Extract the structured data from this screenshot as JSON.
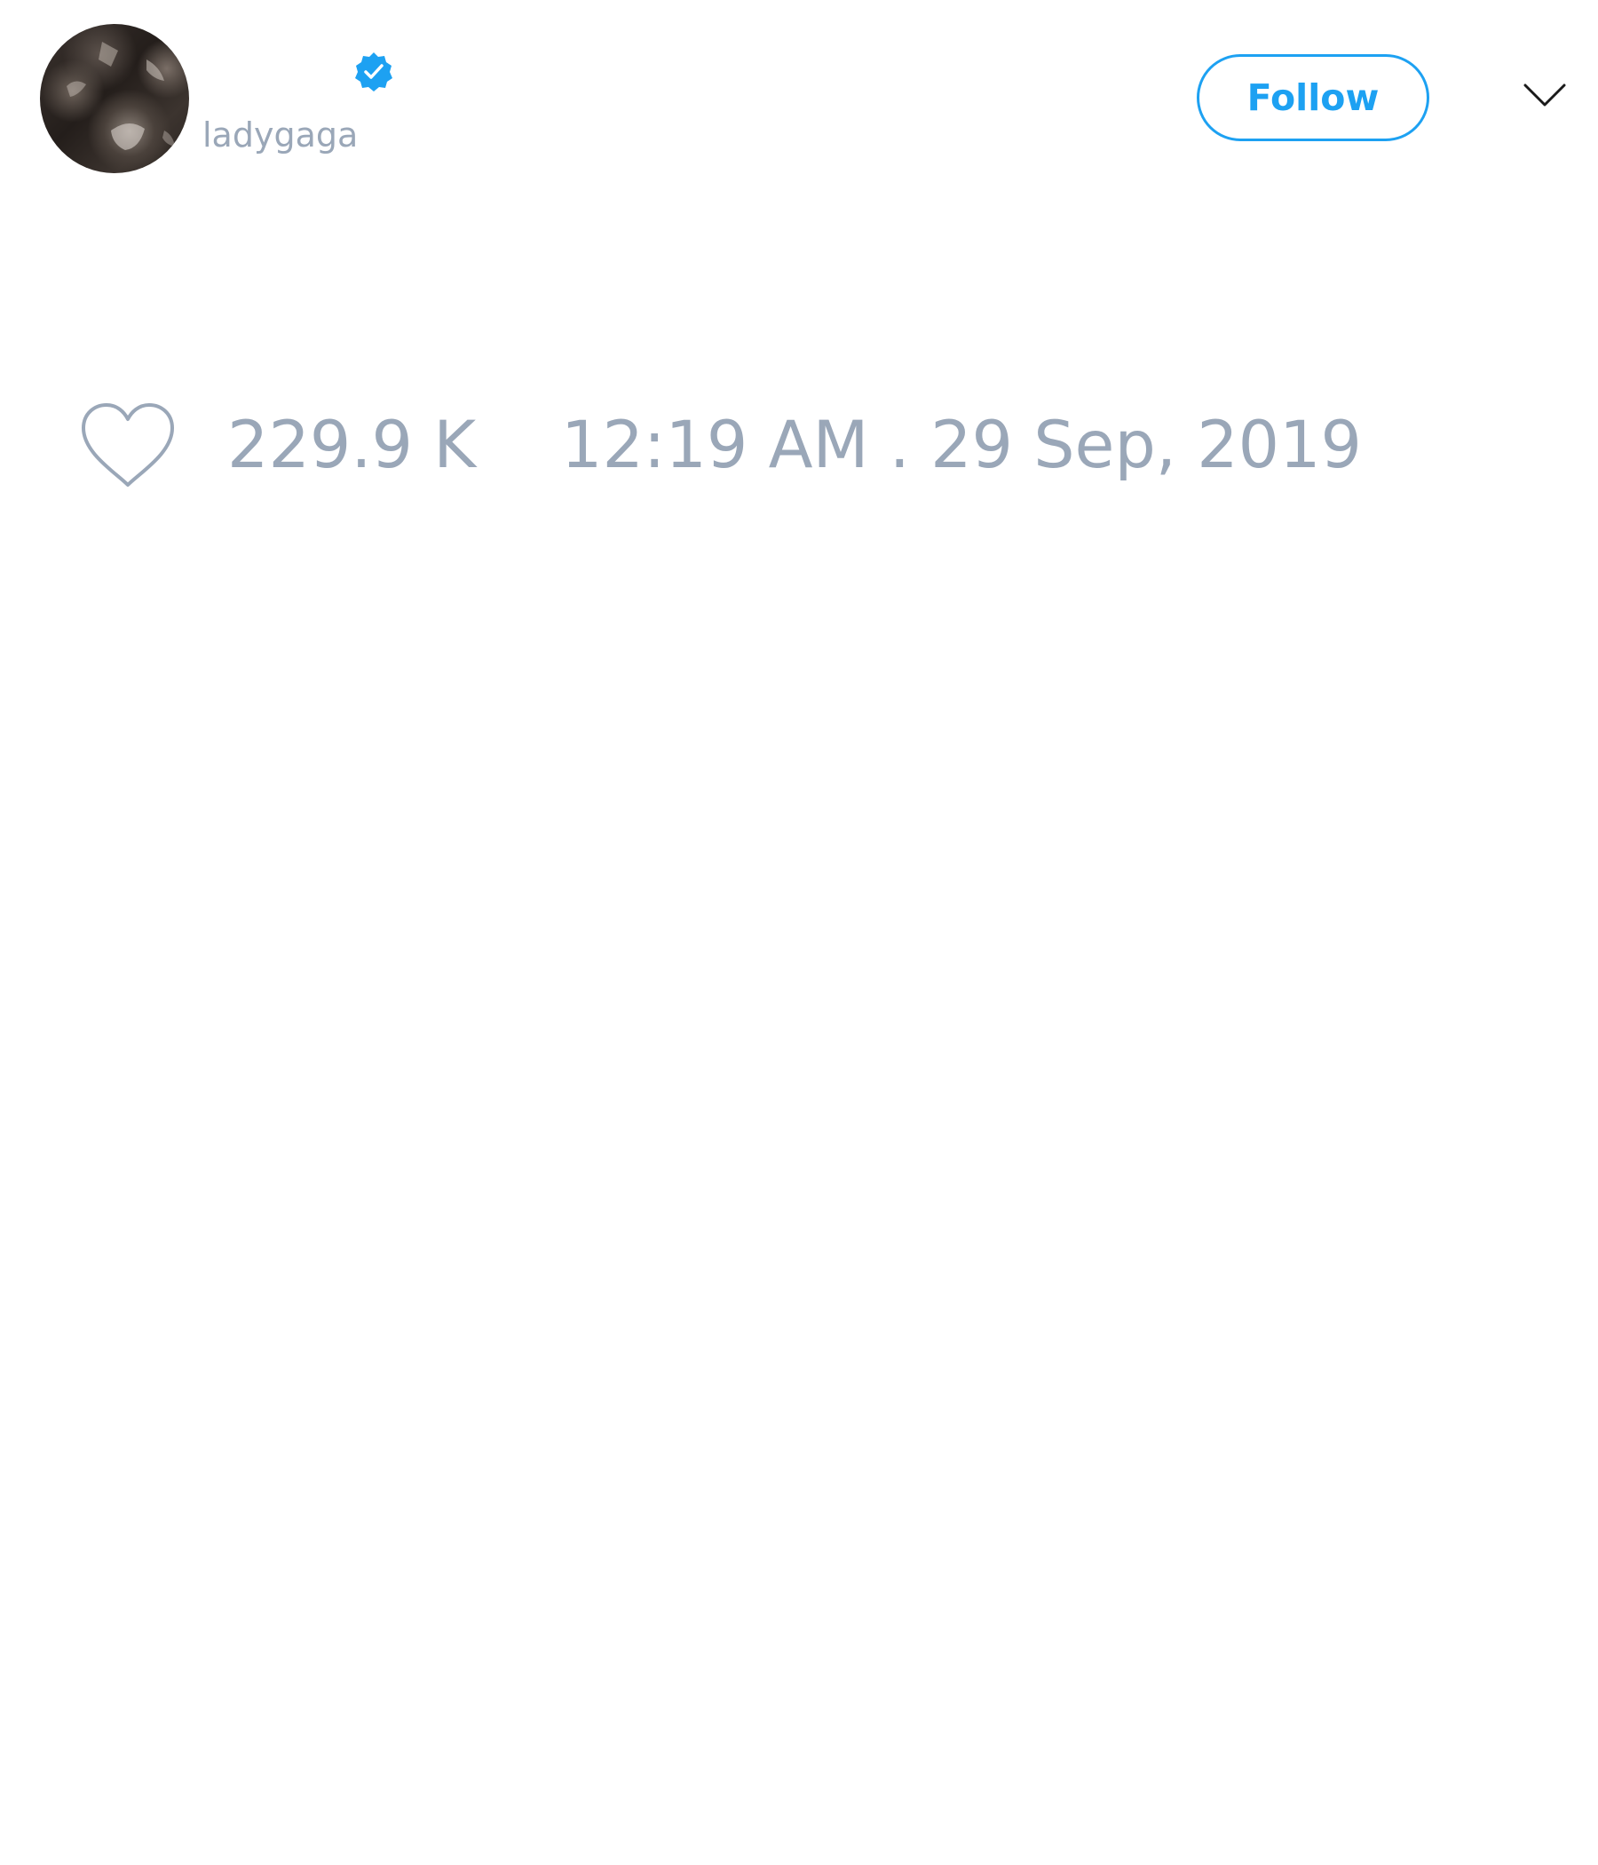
{
  "tweet": {
    "author": {
      "display_name": "",
      "handle": "ladygaga",
      "verified": true,
      "avatar_icon": "avatar-photo"
    },
    "follow_label": "Follow",
    "menu_icon": "chevron-down-icon",
    "likes": {
      "icon": "heart-icon",
      "count": "229.9 K"
    },
    "timestamp": "12:19 AM . 29 Sep, 2019"
  },
  "colors": {
    "accent": "#1da1f2",
    "muted_text": "#9aa7b8",
    "background": "#ffffff"
  }
}
